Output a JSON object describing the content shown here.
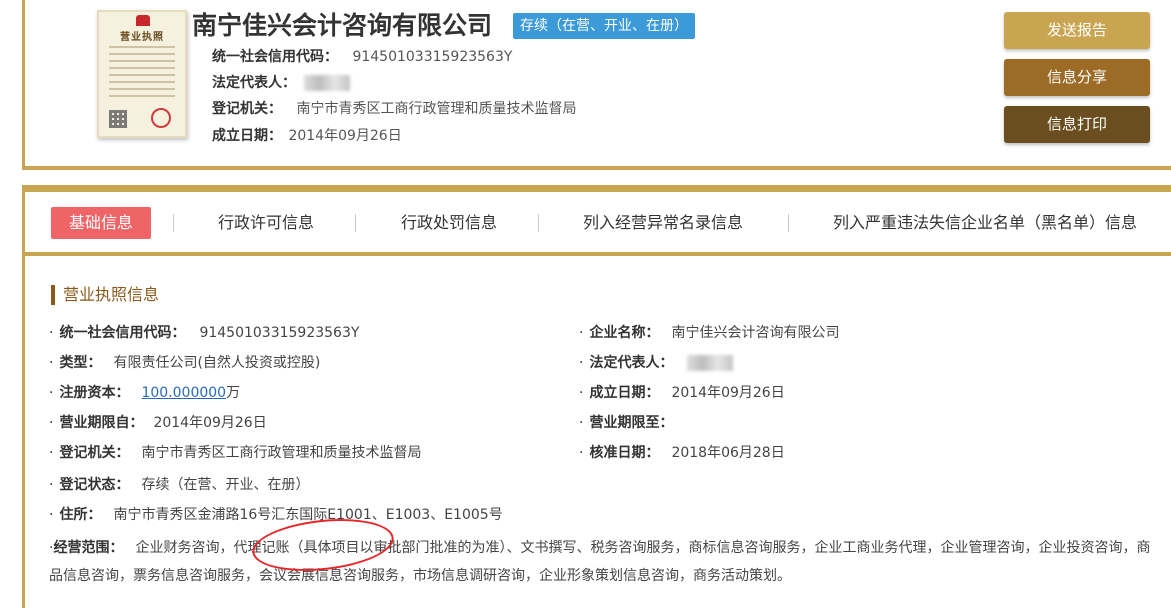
{
  "header": {
    "company_name": "南宁佳兴会计咨询有限公司",
    "status_badge": "存续（在营、开业、在册）",
    "credit_code_label": "统一社会信用代码：",
    "credit_code_value": "91450103315923563Y",
    "legal_rep_label": "法定代表人：",
    "registry_label": "登记机关：",
    "registry_value": "南宁市青秀区工商行政管理和质量技术监督局",
    "founded_label": "成立日期：",
    "founded_value": "2014年09月26日",
    "license_title": "营业执照"
  },
  "actions": {
    "send_report": "发送报告",
    "share": "信息分享",
    "print": "信息打印"
  },
  "tabs": [
    {
      "label": "基础信息"
    },
    {
      "label": "行政许可信息"
    },
    {
      "label": "行政处罚信息"
    },
    {
      "label": "列入经营异常名录信息"
    },
    {
      "label": "列入严重违法失信企业名单（黑名单）信息"
    }
  ],
  "section": {
    "title": "营业执照信息",
    "bullet": "·",
    "fields": {
      "credit_code": {
        "label": "统一社会信用代码：",
        "value": "91450103315923563Y"
      },
      "type": {
        "label": "类型：",
        "value": "有限责任公司(自然人投资或控股)"
      },
      "capital": {
        "label": "注册资本：",
        "value": "100.000000",
        "unit": "万"
      },
      "term_from": {
        "label": "营业期限自：",
        "value": "2014年09月26日"
      },
      "registry": {
        "label": "登记机关：",
        "value": "南宁市青秀区工商行政管理和质量技术监督局"
      },
      "reg_status": {
        "label": "登记状态：",
        "value": "存续（在营、开业、在册）"
      },
      "address": {
        "label": "住所：",
        "value": "南宁市青秀区金浦路16号汇东国际E1001、E1003、E1005号"
      },
      "company_name": {
        "label": "企业名称：",
        "value": "南宁佳兴会计咨询有限公司"
      },
      "legal_rep": {
        "label": "法定代表人："
      },
      "founded": {
        "label": "成立日期：",
        "value": "2014年09月26日"
      },
      "term_to": {
        "label": "营业期限至：",
        "value": ""
      },
      "approved": {
        "label": "核准日期：",
        "value": "2018年06月28日"
      }
    },
    "scope": {
      "label": "经营范围：",
      "value": "企业财务咨询，代理记账（具体项目以审批部门批准的为准）、文书撰写、税务咨询服务，商标信息咨询服务，企业工商业务代理，企业管理咨询，企业投资咨询，商品信息咨询，票务信息咨询服务，会议会展信息咨询服务，市场信息调研咨询，企业形象策划信息咨询，商务活动策划。"
    }
  }
}
